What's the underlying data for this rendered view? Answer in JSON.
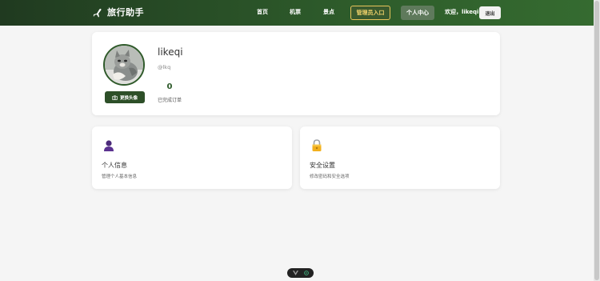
{
  "nav": {
    "brand_title": "旅行助手",
    "brand_icon": "plane-icon",
    "links": [
      {
        "id": "home",
        "label": "首页"
      },
      {
        "id": "tickets",
        "label": "机票"
      },
      {
        "id": "spots",
        "label": "景点"
      }
    ],
    "admin_label": "管理员入口",
    "profile_label": "个人中心",
    "welcome_text": "欢迎，likeqi",
    "logout_label": "退出",
    "colors": {
      "bar": "#2d5a2a",
      "admin_border": "#e8c45a",
      "admin_text": "#f2d36b"
    }
  },
  "profile": {
    "username": "likeqi",
    "handle": "@lkq",
    "completed_orders_value": "0",
    "completed_orders_label": "已完成订单",
    "change_avatar_label": "更换头像",
    "change_avatar_icon": "camera-icon"
  },
  "features": [
    {
      "id": "personal-info",
      "title": "个人信息",
      "desc": "管理个人基本信息",
      "icon": "user-icon"
    },
    {
      "id": "security-settings",
      "title": "安全设置",
      "desc": "修改密码和安全选项",
      "icon": "lock-icon"
    }
  ],
  "colors": {
    "accent": "#2d5a2a",
    "page_bg": "#f5f5f5",
    "card_bg": "#ffffff"
  }
}
